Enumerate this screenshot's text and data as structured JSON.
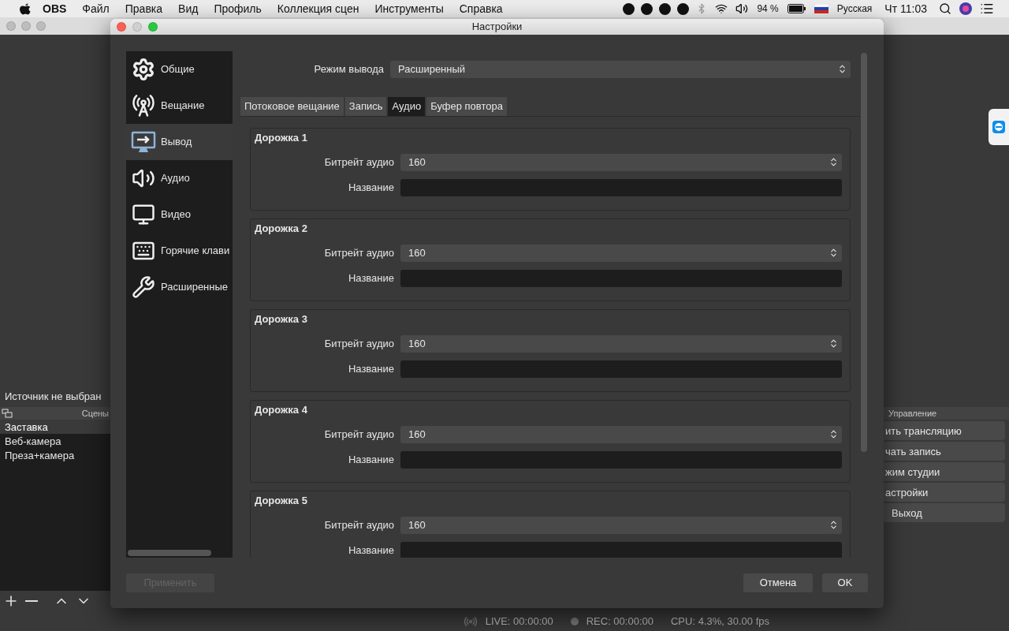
{
  "menubar": {
    "app": "OBS",
    "menus": [
      "Файл",
      "Правка",
      "Вид",
      "Профиль",
      "Коллекция сцен",
      "Инструменты",
      "Справка"
    ],
    "battery": "94 %",
    "input_source": "Русская",
    "clock": "Чт 11:03"
  },
  "main_window": {
    "source_label": "Источник не выбран",
    "scenes": {
      "title": "Сцены",
      "items": [
        {
          "label": "Заставка",
          "selected": true
        },
        {
          "label": "Веб-камера",
          "selected": false
        },
        {
          "label": "Преза+камера",
          "selected": false
        }
      ]
    },
    "controls": {
      "title": "Управление",
      "buttons": [
        "ить трансляцию",
        "чать запись",
        "жим студии",
        "астройки",
        "Выход"
      ]
    },
    "status": {
      "live": "LIVE: 00:00:00",
      "rec": "REC: 00:00:00",
      "cpu": "CPU: 4.3%, 30.00 fps"
    }
  },
  "settings": {
    "title": "Настройки",
    "sidebar": [
      {
        "label": "Общие",
        "selected": false
      },
      {
        "label": "Вещание",
        "selected": false
      },
      {
        "label": "Вывод",
        "selected": true
      },
      {
        "label": "Аудио",
        "selected": false
      },
      {
        "label": "Видео",
        "selected": false
      },
      {
        "label": "Горячие клави",
        "selected": false
      },
      {
        "label": "Расширенные",
        "selected": false
      }
    ],
    "output_mode": {
      "label": "Режим вывода",
      "value": "Расширенный"
    },
    "tabs": [
      {
        "label": "Потоковое вещание",
        "selected": false
      },
      {
        "label": "Запись",
        "selected": false
      },
      {
        "label": "Аудио",
        "selected": true
      },
      {
        "label": "Буфер повтора",
        "selected": false
      }
    ],
    "tracks": [
      {
        "title": "Дорожка 1",
        "bitrate_label": "Битрейт аудио",
        "bitrate": "160",
        "name_label": "Название"
      },
      {
        "title": "Дорожка 2",
        "bitrate_label": "Битрейт аудио",
        "bitrate": "160",
        "name_label": "Название"
      },
      {
        "title": "Дорожка 3",
        "bitrate_label": "Битрейт аудио",
        "bitrate": "160",
        "name_label": "Название"
      },
      {
        "title": "Дорожка 4",
        "bitrate_label": "Битрейт аудио",
        "bitrate": "160",
        "name_label": "Название"
      },
      {
        "title": "Дорожка 5",
        "bitrate_label": "Битрейт аудио",
        "bitrate": "160",
        "name_label": "Название"
      }
    ],
    "buttons": {
      "apply": {
        "label": "Применить",
        "disabled": true
      },
      "cancel": "Отмена",
      "ok": "OK"
    }
  }
}
